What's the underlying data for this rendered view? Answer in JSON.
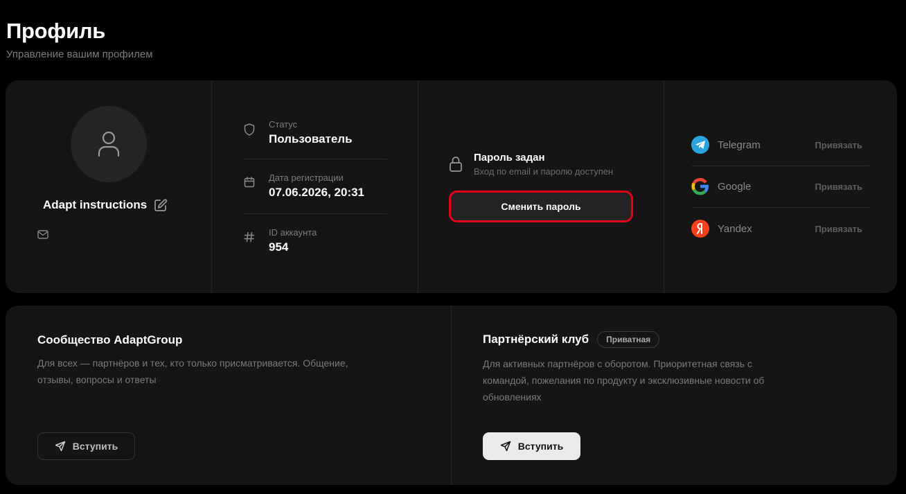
{
  "header": {
    "title": "Профиль",
    "subtitle": "Управление вашим профилем"
  },
  "profile": {
    "name": "Adapt instructions",
    "status_label": "Статус",
    "status_value": "Пользователь",
    "reg_label": "Дата регистрации",
    "reg_value": "07.06.2026, 20:31",
    "id_label": "ID аккаунта",
    "id_value": "954"
  },
  "password": {
    "title": "Пароль задан",
    "subtitle": "Вход по email и паролю доступен",
    "change_button": "Сменить пароль"
  },
  "socials": [
    {
      "name": "Telegram",
      "action": "Привязать",
      "icon": "telegram-icon",
      "color": "#2aa3df"
    },
    {
      "name": "Google",
      "action": "Привязать",
      "icon": "google-icon",
      "color": "#ffffff"
    },
    {
      "name": "Yandex",
      "action": "Привязать",
      "icon": "yandex-icon",
      "color": "#fc3f1d"
    }
  ],
  "community": {
    "title": "Сообщество AdaptGroup",
    "description": "Для всех — партнёров и тех, кто только присматривается. Общение, отзывы, вопросы и ответы",
    "join": "Вступить"
  },
  "partner_club": {
    "title": "Партнёрский клуб",
    "badge": "Приватная",
    "description": "Для активных партнёров с оборотом. Приоритетная связь с командой, пожелания по продукту и эксклюзивные новости об обновлениях",
    "join": "Вступить"
  },
  "colors": {
    "background": "#000000",
    "card": "#151515",
    "highlight": "#e3001b"
  }
}
